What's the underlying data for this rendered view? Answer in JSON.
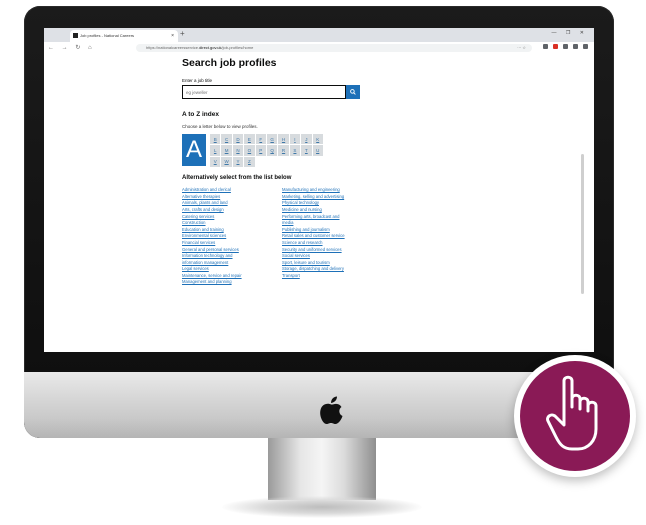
{
  "browser": {
    "tab_title": "Job profiles - National Careers",
    "tab_close": "×",
    "new_tab": "+",
    "window_buttons": "— ❐ ✕",
    "nav_buttons": "← → ↻ ⌂",
    "url_prefix": "https://nationalcareersservice.",
    "url_domain": "direct.gov.uk",
    "url_path": "/job-profiles/home",
    "url_suffix": "··· ☆",
    "ext_colors": [
      "#5f6368",
      "#d93025",
      "#5f6368",
      "#5f6368",
      "#5f6368"
    ]
  },
  "page": {
    "title": "Search job profiles",
    "search_label": "Enter a job title",
    "search_placeholder": "eg jeweller",
    "az_heading": "A to Z index",
    "az_instruction": "Choose a letter below to view profiles.",
    "selected_letter": "A",
    "letters": [
      "B",
      "C",
      "D",
      "E",
      "F",
      "G",
      "H",
      "I",
      "J",
      "K",
      "L",
      "M",
      "N",
      "O",
      "P",
      "Q",
      "R",
      "S",
      "T",
      "U",
      "V",
      "W",
      "Y",
      "Z"
    ],
    "list_heading": "Alternatively select from the list below",
    "categories_left": [
      "Administration and clerical",
      "Alternative therapies",
      "Animals, plants and land",
      "Arts, crafts and design",
      "Catering services",
      "Construction",
      "Education and training",
      "Environmental sciences",
      "Financial services",
      "General and personal services",
      "Information technology and",
      "information management",
      "Legal services",
      "Maintenance, service and repair",
      "Management and planning"
    ],
    "categories_right": [
      "Manufacturing and engineering",
      "Marketing, selling and advertising",
      "Physical technology",
      "Medicine and nursing",
      "Performing arts, broadcast and",
      "media",
      "Publishing and journalism",
      "Retail sales and customer service",
      "Science and research",
      "Security and uniformed services",
      "Social services",
      "Sport, leisure and tourism",
      "Storage, dispatching and delivery",
      "Transport"
    ]
  },
  "colors": {
    "brand_blue": "#1d70b8",
    "link_blue": "#1d70b8",
    "badge": "#8a1a56"
  },
  "icons": [
    "search-icon",
    "apple-logo-icon",
    "hand-pointer-icon"
  ]
}
